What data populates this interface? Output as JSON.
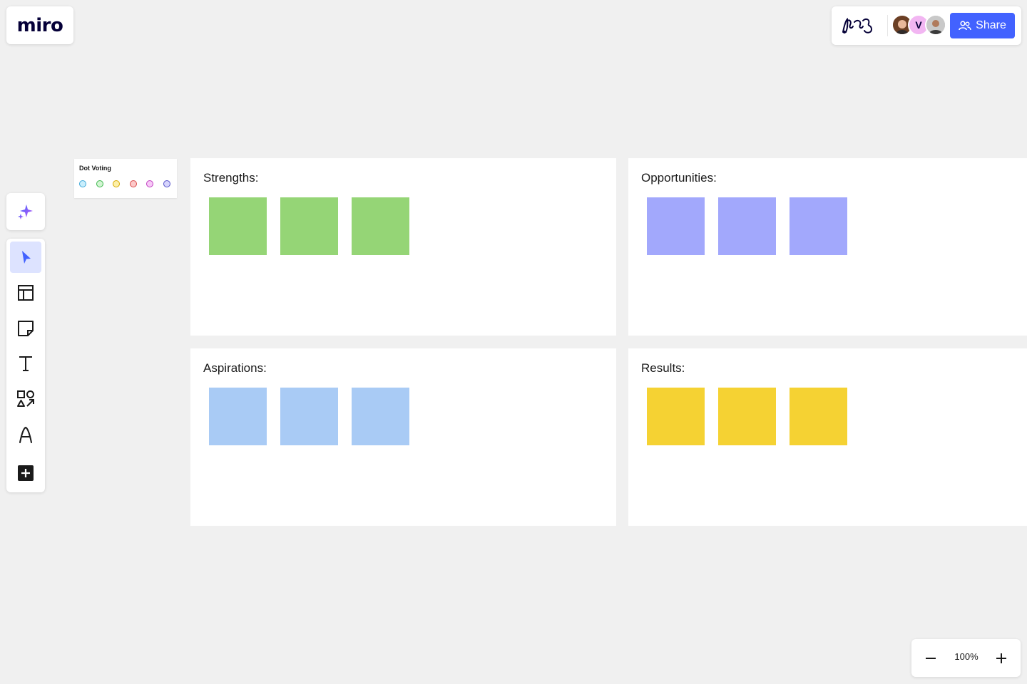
{
  "app": {
    "logo": "miro"
  },
  "collab": {
    "avatar_initial": "V",
    "share_label": "Share"
  },
  "toolbar": {
    "tools": [
      "ai-sparkle-icon",
      "select-cursor-icon",
      "templates-icon",
      "sticky-note-icon",
      "text-icon",
      "shapes-icon",
      "pen-icon",
      "add-more-icon"
    ],
    "active_tool": "select"
  },
  "dot_voting": {
    "title": "Dot Voting",
    "dots": [
      {
        "fill": "#c9eefc",
        "stroke": "#3fa9d9"
      },
      {
        "fill": "#d2f5d2",
        "stroke": "#3fb84f"
      },
      {
        "fill": "#fdf0a8",
        "stroke": "#d6a800"
      },
      {
        "fill": "#fcc9c9",
        "stroke": "#d94a4a"
      },
      {
        "fill": "#f7c9f7",
        "stroke": "#c13fc1"
      },
      {
        "fill": "#d6d4fc",
        "stroke": "#5553c9"
      }
    ]
  },
  "frames": [
    {
      "title": "Strengths:",
      "color": "#95d576",
      "stickies": 3
    },
    {
      "title": "Opportunities:",
      "color": "#a2a8fc",
      "stickies": 3
    },
    {
      "title": "Aspirations:",
      "color": "#a9cbf5",
      "stickies": 3
    },
    {
      "title": "Results:",
      "color": "#f5d233",
      "stickies": 3
    }
  ],
  "zoom": {
    "level": "100%"
  }
}
